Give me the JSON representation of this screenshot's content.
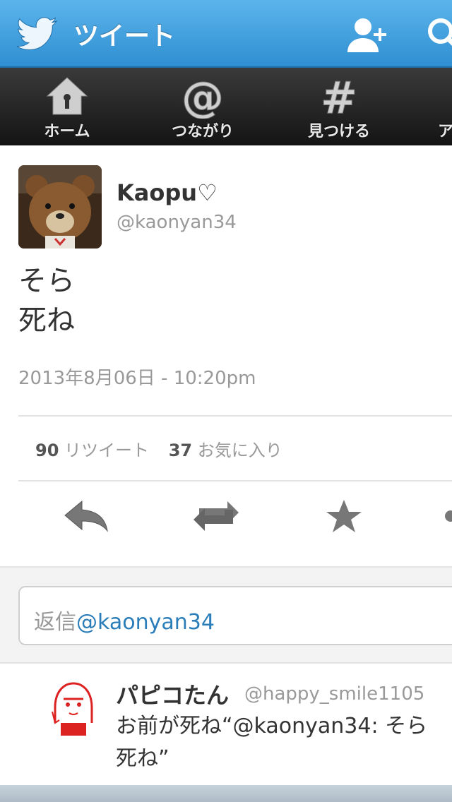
{
  "header": {
    "title": "ツイート",
    "icons": [
      "twitter-bird-icon",
      "add-user-icon",
      "search-icon"
    ]
  },
  "nav": {
    "items": [
      {
        "label": "ホーム",
        "icon": "home-icon"
      },
      {
        "label": "つながり",
        "icon": "at-icon"
      },
      {
        "label": "見つける",
        "icon": "hashtag-icon"
      },
      {
        "label": "ア",
        "icon": "me-icon"
      }
    ]
  },
  "tweet": {
    "name": "Kaopu♡",
    "handle": "@kaonyan34",
    "text_lines": [
      "そら",
      "死ね"
    ],
    "timestamp": "2013年8月06日 - 10:20pm",
    "retweets_count": "90",
    "retweets_label": "リツイート",
    "favorites_count": "37",
    "favorites_label": "お気に入り",
    "actions": [
      "reply-icon",
      "retweet-icon",
      "favorite-icon",
      "more-icon"
    ]
  },
  "reply_input": {
    "prefix": "返信",
    "mention": "@kaonyan34"
  },
  "reply": {
    "name": "パピコたん",
    "handle": "@happy_smile1105",
    "text_lines": [
      "お前が死ね“@kaonyan34: そら",
      "死ね”"
    ]
  },
  "colors": {
    "header_blue": "#3d9ee0",
    "nav_dark": "#1c1c1c",
    "link_blue": "#2a7db8",
    "muted_gray": "#999999"
  }
}
